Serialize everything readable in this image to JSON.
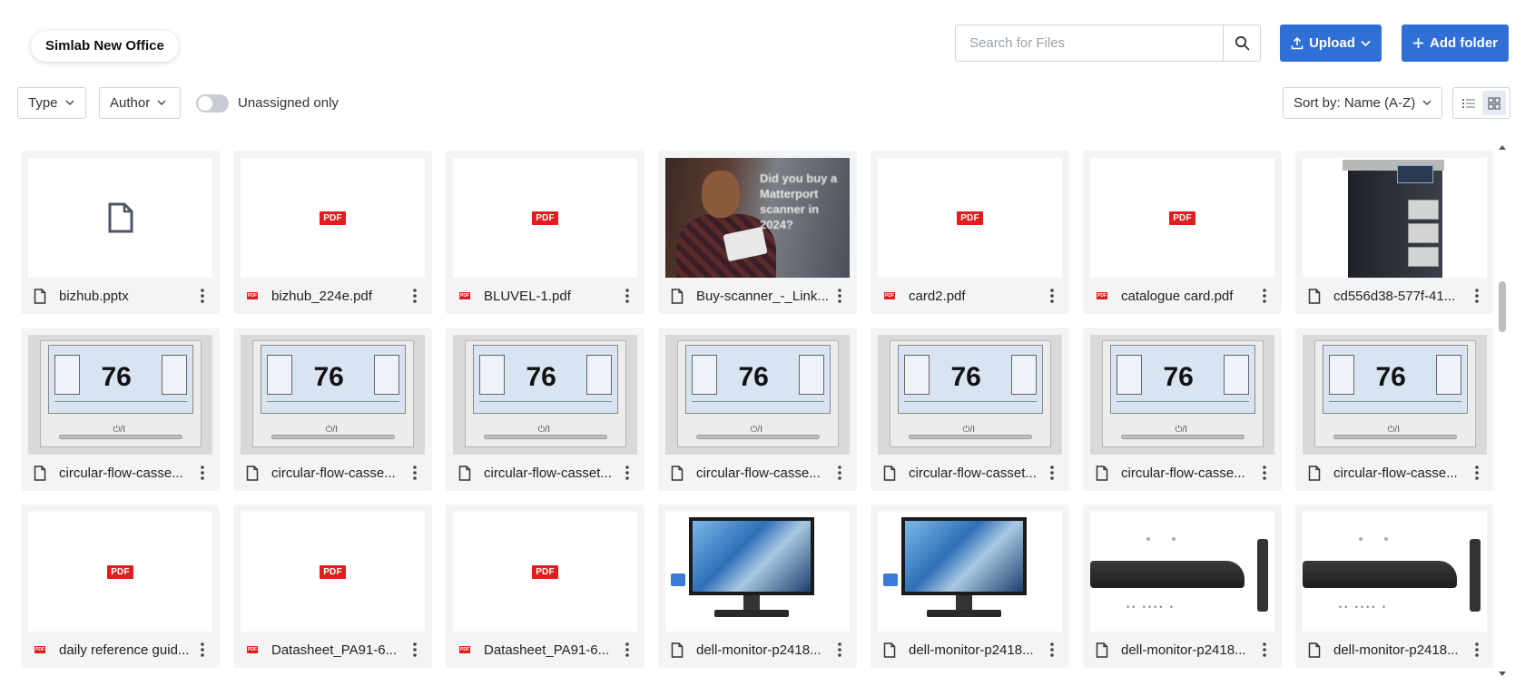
{
  "project": {
    "name": "Simlab New Office"
  },
  "search": {
    "placeholder": "Search for Files"
  },
  "actions": {
    "upload_label": "Upload",
    "add_folder_label": "Add folder"
  },
  "filters": {
    "type_label": "Type",
    "author_label": "Author",
    "unassigned_label": "Unassigned only",
    "unassigned_on": false
  },
  "sort": {
    "label": "Sort by: Name (A-Z)"
  },
  "view": {
    "active": "grid"
  },
  "colors": {
    "accent": "#2f6fd6",
    "pdf_red": "#e11d1d",
    "card_bg": "#f3f4f6"
  },
  "files": [
    {
      "name": "bizhub.pptx",
      "kind": "doc",
      "thumb": "generic-file-icon"
    },
    {
      "name": "bizhub_224e.pdf",
      "kind": "pdf",
      "thumb": "pdf-badge"
    },
    {
      "name": "BLUVEL-1.pdf",
      "kind": "pdf",
      "thumb": "pdf-badge"
    },
    {
      "name": "Buy-scanner_-_Link...",
      "kind": "doc",
      "thumb": "photo-man-tablet",
      "thumb_text": "Did you buy a Matterport scanner in 2024?"
    },
    {
      "name": "card2.pdf",
      "kind": "pdf",
      "thumb": "pdf-badge"
    },
    {
      "name": "catalogue card.pdf",
      "kind": "pdf",
      "thumb": "pdf-badge"
    },
    {
      "name": "cd556d38-577f-41...",
      "kind": "doc",
      "thumb": "printer-photo"
    },
    {
      "name": "circular-flow-casse...",
      "kind": "doc",
      "thumb": "thermostat",
      "thumb_temp": "76"
    },
    {
      "name": "circular-flow-casse...",
      "kind": "doc",
      "thumb": "thermostat",
      "thumb_temp": "76"
    },
    {
      "name": "circular-flow-casset...",
      "kind": "doc",
      "thumb": "thermostat",
      "thumb_temp": "76"
    },
    {
      "name": "circular-flow-casse...",
      "kind": "doc",
      "thumb": "thermostat",
      "thumb_temp": "76"
    },
    {
      "name": "circular-flow-casset...",
      "kind": "doc",
      "thumb": "thermostat",
      "thumb_temp": "76"
    },
    {
      "name": "circular-flow-casse...",
      "kind": "doc",
      "thumb": "thermostat",
      "thumb_temp": "76"
    },
    {
      "name": "circular-flow-casse...",
      "kind": "doc",
      "thumb": "thermostat",
      "thumb_temp": "76"
    },
    {
      "name": "daily reference guid...",
      "kind": "pdf",
      "thumb": "pdf-badge"
    },
    {
      "name": "Datasheet_PA91-6...",
      "kind": "pdf",
      "thumb": "pdf-badge"
    },
    {
      "name": "Datasheet_PA91-6...",
      "kind": "pdf",
      "thumb": "pdf-badge"
    },
    {
      "name": "dell-monitor-p2418...",
      "kind": "doc",
      "thumb": "monitor-front"
    },
    {
      "name": "dell-monitor-p2418...",
      "kind": "doc",
      "thumb": "monitor-front"
    },
    {
      "name": "dell-monitor-p2418...",
      "kind": "doc",
      "thumb": "monitor-side"
    },
    {
      "name": "dell-monitor-p2418...",
      "kind": "doc",
      "thumb": "monitor-side"
    }
  ]
}
